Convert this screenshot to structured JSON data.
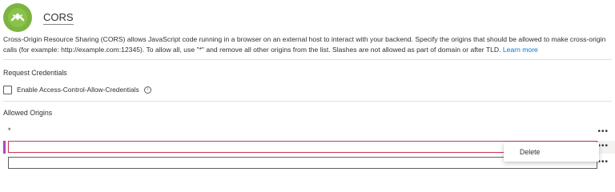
{
  "header": {
    "title": "CORS",
    "logo_icon": "cors-logo-icon",
    "logo_color": "#7cb342"
  },
  "description": {
    "text": "Cross-Origin Resource Sharing (CORS) allows JavaScript code running in a browser on an external host to interact with your backend. Specify the origins that should be allowed to make cross-origin calls (for example: http://example.com:12345). To allow all, use \"*\" and remove all other origins from the list. Slashes are not allowed as part of domain or after TLD.",
    "link_label": "Learn more",
    "link_color": "#0078d4"
  },
  "request_credentials": {
    "label": "Request Credentials",
    "checkbox_label": "Enable Access-Control-Allow-Credentials",
    "checked": false,
    "info_icon": "info-icon",
    "info_glyph": "i"
  },
  "allowed_origins": {
    "label": "Allowed Origins",
    "row_menu_glyph": "•••",
    "rows": [
      {
        "value": "*",
        "type": "text"
      },
      {
        "value": "",
        "type": "input",
        "active": true
      },
      {
        "value": "",
        "type": "input",
        "active": false
      }
    ]
  },
  "context_menu": {
    "items": [
      {
        "label": "Delete"
      }
    ]
  },
  "colors": {
    "selected_marker": "#b146c2",
    "active_input_border": "#c93a57"
  }
}
